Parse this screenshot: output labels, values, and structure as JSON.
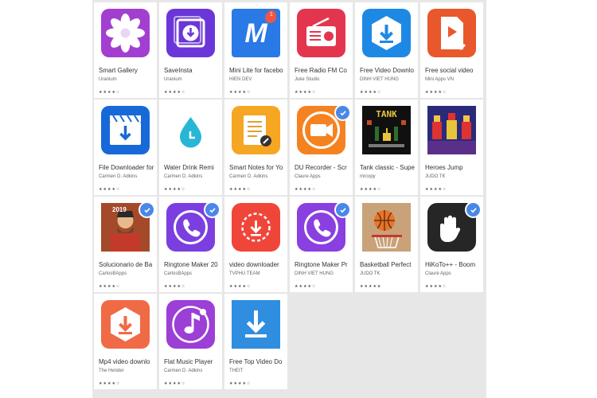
{
  "apps": [
    {
      "title": "Smart Gallery",
      "developer": "Uranium",
      "rating": "★★★★☆",
      "icon": "flower-icon",
      "bg": "#a23fd0",
      "verified": false
    },
    {
      "title": "SaveInsta",
      "developer": "Uranium",
      "rating": "★★★★☆",
      "icon": "download-icon",
      "bg": "#6b36d9",
      "verified": false
    },
    {
      "title": "Mini Lite for facebo",
      "developer": "HIEN DEV",
      "rating": "★★★★☆",
      "icon": "messenger-m-icon",
      "bg": "#2979e6",
      "verified": false,
      "notification": "1"
    },
    {
      "title": "Free Radio FM Co",
      "developer": "Juke Studio",
      "rating": "★★★★☆",
      "icon": "radio-icon",
      "bg": "#e4354f",
      "verified": false
    },
    {
      "title": "Free Video Downlo",
      "developer": "DINH VIET HUNG",
      "rating": "★★★★☆",
      "icon": "hexagon-download-icon",
      "bg": "#1e88e5",
      "verified": false
    },
    {
      "title": "Free social video",
      "developer": "Mini Apps VN",
      "rating": "★★★★☆",
      "icon": "video-file-icon",
      "bg": "#e8582c",
      "verified": false
    },
    {
      "title": "File Downloader for",
      "developer": "Carmen D. Adkins",
      "rating": "★★★★☆",
      "icon": "clapper-download-icon",
      "bg": "#1869d8",
      "verified": false
    },
    {
      "title": "Water Drink Remi",
      "developer": "Carmen D. Adkins",
      "rating": "★★★★☆",
      "icon": "water-drop-icon",
      "bg": "#ffffff",
      "verified": false
    },
    {
      "title": "Smart Notes for Yo",
      "developer": "Carmen D. Adkins",
      "rating": "★★★★☆",
      "icon": "notes-icon",
      "bg": "#f5a623",
      "verified": false
    },
    {
      "title": "DU Recorder - Scr",
      "developer": "Claure Apps",
      "rating": "★★★★☆",
      "icon": "screen-recorder-icon",
      "bg": "#f58220",
      "verified": true
    },
    {
      "title": "Tank classic - Supe",
      "developer": "mrcopy",
      "rating": "★★★★☆",
      "icon": "tank-game-icon",
      "bg": "#101010",
      "verified": false
    },
    {
      "title": "Heroes Jump",
      "developer": "JUDO TK",
      "rating": "★★★★☆",
      "icon": "pixel-heroes-icon",
      "bg": "#2b2a7a",
      "verified": false
    },
    {
      "title": "Solucionario de Ba",
      "developer": "CarlosBApps",
      "rating": "★★★★☆",
      "icon": "portrait-icon",
      "bg": "#2f8fb0",
      "verified": true,
      "year": "2019"
    },
    {
      "title": "Ringtone Maker 20",
      "developer": "CarlosBApps",
      "rating": "★★★★☆",
      "icon": "phone-call-icon",
      "bg": "#7b3fe0",
      "verified": true
    },
    {
      "title": "video downloader",
      "developer": "TVPHU TEAM",
      "rating": "★★★★☆",
      "icon": "circle-download-icon",
      "bg": "#f0463a",
      "verified": false
    },
    {
      "title": "Ringtone Maker Pr",
      "developer": "DINH VIET HUNG",
      "rating": "★★★★☆",
      "icon": "phone-call-icon",
      "bg": "#8a3fe0",
      "verified": true
    },
    {
      "title": "Basketball Perfect",
      "developer": "JUDO TK",
      "rating": "★★★★★",
      "icon": "basketball-icon",
      "bg": "#c9a27a",
      "verified": false
    },
    {
      "title": "HiKoTo++ - Boom",
      "developer": "Claure Apps",
      "rating": "★★★★☆",
      "icon": "hand-icon",
      "bg": "#262626",
      "verified": true
    },
    {
      "title": "Mp4 video downlo",
      "developer": "The Hender",
      "rating": "★★★★☆",
      "icon": "hexagon-download-icon",
      "bg": "#f06a45",
      "verified": false
    },
    {
      "title": "Flat Music Player",
      "developer": "Carmen D. Adkins",
      "rating": "★★★★☆",
      "icon": "music-note-icon",
      "bg": "#9c3fd6",
      "verified": false
    },
    {
      "title": "Free Top Video Do",
      "developer": "THEIT",
      "rating": "★★★★☆",
      "icon": "arrow-download-icon",
      "bg": "#2f8ee0",
      "verified": false
    }
  ]
}
